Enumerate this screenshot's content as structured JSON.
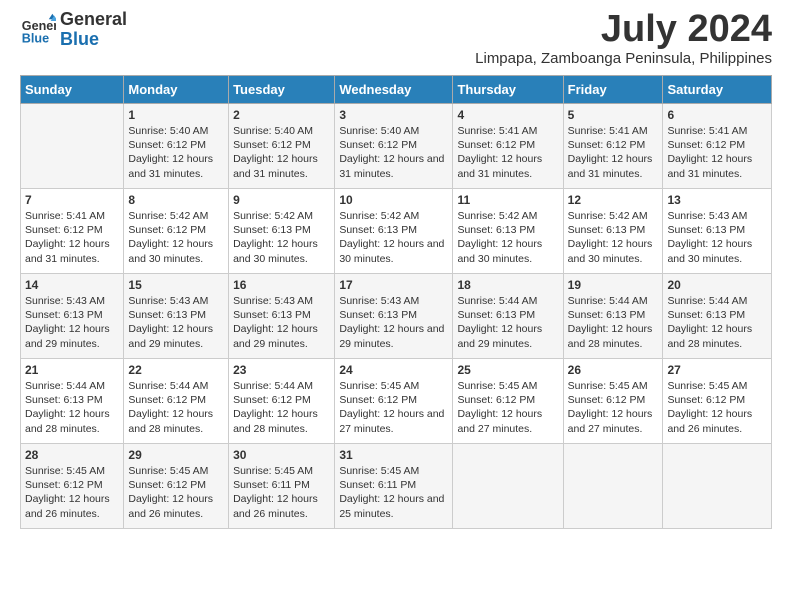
{
  "logo": {
    "text_general": "General",
    "text_blue": "Blue"
  },
  "title": "July 2024",
  "subtitle": "Limpapa, Zamboanga Peninsula, Philippines",
  "days_of_week": [
    "Sunday",
    "Monday",
    "Tuesday",
    "Wednesday",
    "Thursday",
    "Friday",
    "Saturday"
  ],
  "weeks": [
    [
      {
        "day": "",
        "sunrise": "",
        "sunset": "",
        "daylight": ""
      },
      {
        "day": "1",
        "sunrise": "Sunrise: 5:40 AM",
        "sunset": "Sunset: 6:12 PM",
        "daylight": "Daylight: 12 hours and 31 minutes."
      },
      {
        "day": "2",
        "sunrise": "Sunrise: 5:40 AM",
        "sunset": "Sunset: 6:12 PM",
        "daylight": "Daylight: 12 hours and 31 minutes."
      },
      {
        "day": "3",
        "sunrise": "Sunrise: 5:40 AM",
        "sunset": "Sunset: 6:12 PM",
        "daylight": "Daylight: 12 hours and 31 minutes."
      },
      {
        "day": "4",
        "sunrise": "Sunrise: 5:41 AM",
        "sunset": "Sunset: 6:12 PM",
        "daylight": "Daylight: 12 hours and 31 minutes."
      },
      {
        "day": "5",
        "sunrise": "Sunrise: 5:41 AM",
        "sunset": "Sunset: 6:12 PM",
        "daylight": "Daylight: 12 hours and 31 minutes."
      },
      {
        "day": "6",
        "sunrise": "Sunrise: 5:41 AM",
        "sunset": "Sunset: 6:12 PM",
        "daylight": "Daylight: 12 hours and 31 minutes."
      }
    ],
    [
      {
        "day": "7",
        "sunrise": "Sunrise: 5:41 AM",
        "sunset": "Sunset: 6:12 PM",
        "daylight": "Daylight: 12 hours and 31 minutes."
      },
      {
        "day": "8",
        "sunrise": "Sunrise: 5:42 AM",
        "sunset": "Sunset: 6:12 PM",
        "daylight": "Daylight: 12 hours and 30 minutes."
      },
      {
        "day": "9",
        "sunrise": "Sunrise: 5:42 AM",
        "sunset": "Sunset: 6:13 PM",
        "daylight": "Daylight: 12 hours and 30 minutes."
      },
      {
        "day": "10",
        "sunrise": "Sunrise: 5:42 AM",
        "sunset": "Sunset: 6:13 PM",
        "daylight": "Daylight: 12 hours and 30 minutes."
      },
      {
        "day": "11",
        "sunrise": "Sunrise: 5:42 AM",
        "sunset": "Sunset: 6:13 PM",
        "daylight": "Daylight: 12 hours and 30 minutes."
      },
      {
        "day": "12",
        "sunrise": "Sunrise: 5:42 AM",
        "sunset": "Sunset: 6:13 PM",
        "daylight": "Daylight: 12 hours and 30 minutes."
      },
      {
        "day": "13",
        "sunrise": "Sunrise: 5:43 AM",
        "sunset": "Sunset: 6:13 PM",
        "daylight": "Daylight: 12 hours and 30 minutes."
      }
    ],
    [
      {
        "day": "14",
        "sunrise": "Sunrise: 5:43 AM",
        "sunset": "Sunset: 6:13 PM",
        "daylight": "Daylight: 12 hours and 29 minutes."
      },
      {
        "day": "15",
        "sunrise": "Sunrise: 5:43 AM",
        "sunset": "Sunset: 6:13 PM",
        "daylight": "Daylight: 12 hours and 29 minutes."
      },
      {
        "day": "16",
        "sunrise": "Sunrise: 5:43 AM",
        "sunset": "Sunset: 6:13 PM",
        "daylight": "Daylight: 12 hours and 29 minutes."
      },
      {
        "day": "17",
        "sunrise": "Sunrise: 5:43 AM",
        "sunset": "Sunset: 6:13 PM",
        "daylight": "Daylight: 12 hours and 29 minutes."
      },
      {
        "day": "18",
        "sunrise": "Sunrise: 5:44 AM",
        "sunset": "Sunset: 6:13 PM",
        "daylight": "Daylight: 12 hours and 29 minutes."
      },
      {
        "day": "19",
        "sunrise": "Sunrise: 5:44 AM",
        "sunset": "Sunset: 6:13 PM",
        "daylight": "Daylight: 12 hours and 28 minutes."
      },
      {
        "day": "20",
        "sunrise": "Sunrise: 5:44 AM",
        "sunset": "Sunset: 6:13 PM",
        "daylight": "Daylight: 12 hours and 28 minutes."
      }
    ],
    [
      {
        "day": "21",
        "sunrise": "Sunrise: 5:44 AM",
        "sunset": "Sunset: 6:13 PM",
        "daylight": "Daylight: 12 hours and 28 minutes."
      },
      {
        "day": "22",
        "sunrise": "Sunrise: 5:44 AM",
        "sunset": "Sunset: 6:12 PM",
        "daylight": "Daylight: 12 hours and 28 minutes."
      },
      {
        "day": "23",
        "sunrise": "Sunrise: 5:44 AM",
        "sunset": "Sunset: 6:12 PM",
        "daylight": "Daylight: 12 hours and 28 minutes."
      },
      {
        "day": "24",
        "sunrise": "Sunrise: 5:45 AM",
        "sunset": "Sunset: 6:12 PM",
        "daylight": "Daylight: 12 hours and 27 minutes."
      },
      {
        "day": "25",
        "sunrise": "Sunrise: 5:45 AM",
        "sunset": "Sunset: 6:12 PM",
        "daylight": "Daylight: 12 hours and 27 minutes."
      },
      {
        "day": "26",
        "sunrise": "Sunrise: 5:45 AM",
        "sunset": "Sunset: 6:12 PM",
        "daylight": "Daylight: 12 hours and 27 minutes."
      },
      {
        "day": "27",
        "sunrise": "Sunrise: 5:45 AM",
        "sunset": "Sunset: 6:12 PM",
        "daylight": "Daylight: 12 hours and 26 minutes."
      }
    ],
    [
      {
        "day": "28",
        "sunrise": "Sunrise: 5:45 AM",
        "sunset": "Sunset: 6:12 PM",
        "daylight": "Daylight: 12 hours and 26 minutes."
      },
      {
        "day": "29",
        "sunrise": "Sunrise: 5:45 AM",
        "sunset": "Sunset: 6:12 PM",
        "daylight": "Daylight: 12 hours and 26 minutes."
      },
      {
        "day": "30",
        "sunrise": "Sunrise: 5:45 AM",
        "sunset": "Sunset: 6:11 PM",
        "daylight": "Daylight: 12 hours and 26 minutes."
      },
      {
        "day": "31",
        "sunrise": "Sunrise: 5:45 AM",
        "sunset": "Sunset: 6:11 PM",
        "daylight": "Daylight: 12 hours and 25 minutes."
      },
      {
        "day": "",
        "sunrise": "",
        "sunset": "",
        "daylight": ""
      },
      {
        "day": "",
        "sunrise": "",
        "sunset": "",
        "daylight": ""
      },
      {
        "day": "",
        "sunrise": "",
        "sunset": "",
        "daylight": ""
      }
    ]
  ]
}
